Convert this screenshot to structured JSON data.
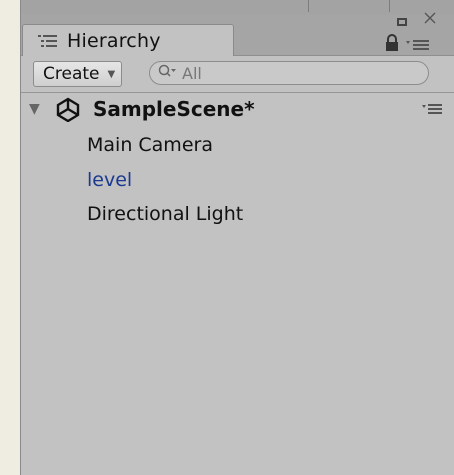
{
  "hierarchy": {
    "tab_label": "Hierarchy",
    "create_label": "Create",
    "search_placeholder": "All",
    "scene": {
      "name": "SampleScene*",
      "items": [
        {
          "label": "Main Camera"
        },
        {
          "label": "level",
          "is_prefab": true
        },
        {
          "label": "Directional Light"
        }
      ]
    },
    "icons": [
      "list-icon",
      "lock-icon",
      "menu-icon",
      "close-icon",
      "maximize-icon",
      "search-icon",
      "unity-icon",
      "fold-arrow-icon",
      "dropdown-arrow-icon"
    ],
    "colors": {
      "panel_bg": "#c2c2c2",
      "prefab_text": "#1b3a8f",
      "outer_bg": "#efece2"
    }
  }
}
